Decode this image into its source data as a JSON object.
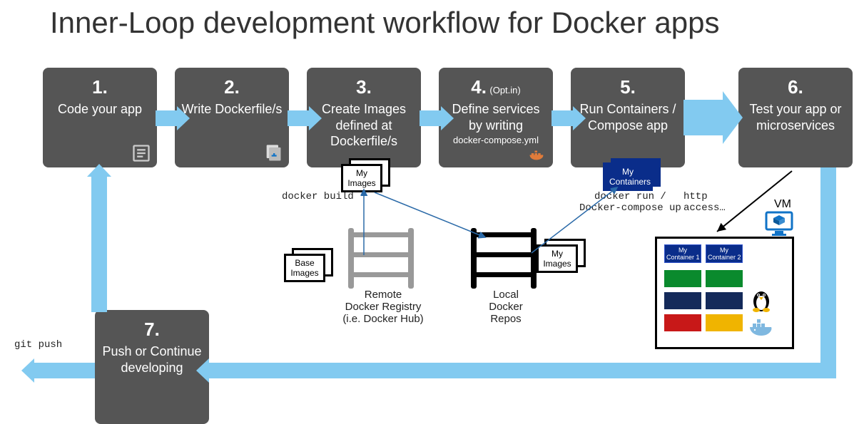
{
  "title": "Inner-Loop development workflow for Docker apps",
  "steps": {
    "s1": {
      "num": "1.",
      "txt": "Code\nyour app"
    },
    "s2": {
      "num": "2.",
      "txt": "Write\nDockerfile/s"
    },
    "s3": {
      "num": "3.",
      "txt": "Create Images\ndefined at\nDockerfile/s"
    },
    "s4": {
      "num": "4.",
      "opt": "(Opt.in)",
      "txt": "Define services\nby writing",
      "sub": "docker-compose.yml"
    },
    "s5": {
      "num": "5.",
      "txt": "Run\nContainers /\nCompose app"
    },
    "s6": {
      "num": "6.",
      "txt": "Test\nyour app or\nmicroservices"
    },
    "s7": {
      "num": "7.",
      "txt": "Push or\nContinue\ndeveloping"
    }
  },
  "commands": {
    "docker_build": "docker build",
    "docker_run": "docker run /\nDocker-compose up",
    "http_access": "http\naccess…",
    "git_push": "git push"
  },
  "cards": {
    "my_images": "My\nImages",
    "base_images": "Base\nImages",
    "my_containers": "My\nContainers",
    "my_container1": "My\nContainer 1",
    "my_container2": "My\nContainer 2"
  },
  "labels": {
    "remote_registry": "Remote\nDocker Registry\n(i.e. Docker Hub)",
    "local_repos": "Local\nDocker\nRepos",
    "vm": "VM"
  },
  "colors": {
    "step_bg": "#555555",
    "arrow": "#82caf0",
    "container_blue": "#0a2d8a",
    "green": "#0a8a2d",
    "navy": "#142a5a",
    "red": "#c81818",
    "yellow": "#f0b400",
    "accent_blue": "#1173c7"
  }
}
